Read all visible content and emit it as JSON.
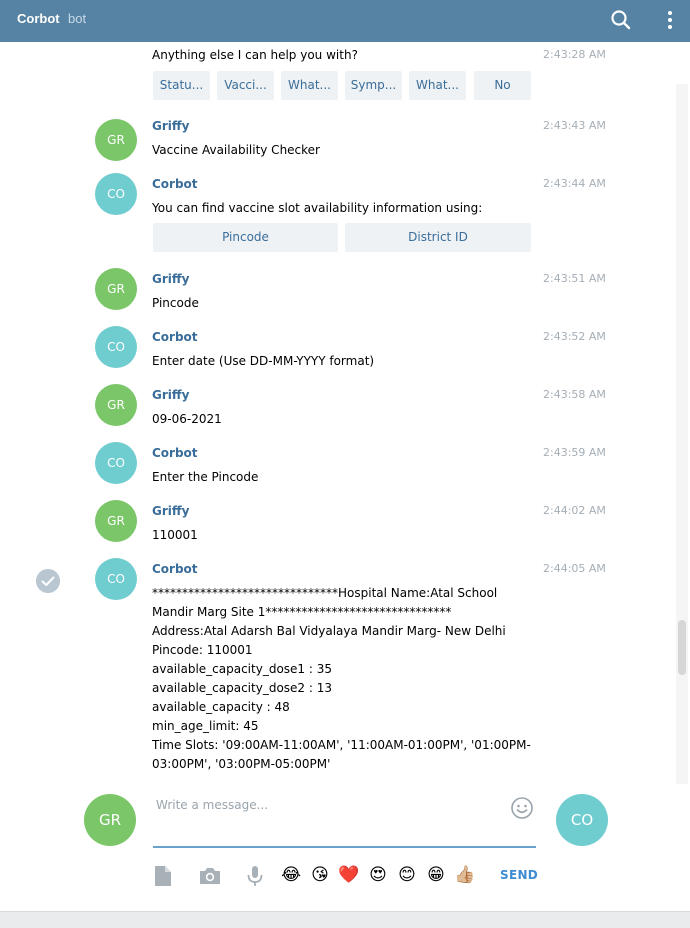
{
  "header": {
    "title": "Corbot",
    "subtitle": "bot"
  },
  "messages": [
    {
      "id": "m0",
      "author": "",
      "time": "2:43:28 AM",
      "text": "Anything else I can help you with?",
      "buttons": [
        "Statu...",
        "Vacci...",
        "What...",
        "Symp...",
        "What...",
        "No"
      ]
    },
    {
      "id": "m1",
      "avatar": "GR",
      "author": "Griffy",
      "time": "2:43:43 AM",
      "text": "Vaccine Availability Checker"
    },
    {
      "id": "m2",
      "avatar": "CO",
      "author": "Corbot",
      "time": "2:43:44 AM",
      "text": "You can find vaccine slot availability information using:",
      "buttons": [
        "Pincode",
        "District ID"
      ]
    },
    {
      "id": "m3",
      "avatar": "GR",
      "author": "Griffy",
      "time": "2:43:51 AM",
      "text": "Pincode"
    },
    {
      "id": "m4",
      "avatar": "CO",
      "author": "Corbot",
      "time": "2:43:52 AM",
      "text": "Enter date (Use DD-MM-YYYY format)"
    },
    {
      "id": "m5",
      "avatar": "GR",
      "author": "Griffy",
      "time": "2:43:58 AM",
      "text": "09-06-2021"
    },
    {
      "id": "m6",
      "avatar": "CO",
      "author": "Corbot",
      "time": "2:43:59 AM",
      "text": "Enter the Pincode"
    },
    {
      "id": "m7",
      "avatar": "GR",
      "author": "Griffy",
      "time": "2:44:02 AM",
      "text": "110001"
    },
    {
      "id": "m8",
      "avatar": "CO",
      "author": "Corbot",
      "time": "2:44:05 AM",
      "lines": [
        "*******************************Hospital Name:Atal School",
        "Mandir Marg Site 1*******************************",
        "Address:Atal Adarsh Bal Vidyalaya Mandir Marg- New Delhi",
        "Pincode: 110001",
        "available_capacity_dose1 : 35",
        "available_capacity_dose2 : 13",
        "available_capacity : 48",
        "min_age_limit: 45",
        "Time Slots: '09:00AM-11:00AM', '11:00AM-01:00PM', '01:00PM-",
        "03:00PM', '03:00PM-05:00PM'"
      ]
    }
  ],
  "composer": {
    "placeholder": "Write a message...",
    "me_avatar": "GR",
    "peer_avatar": "CO",
    "send_label": "SEND",
    "emojis": [
      "😂",
      "😘",
      "❤️",
      "😍",
      "😊",
      "😁",
      "👍🏼"
    ]
  },
  "colors": {
    "header": "#5682a3",
    "link": "#3a6d99",
    "avatar_gr": "#7ac668",
    "avatar_co": "#6fcccf",
    "send": "#3d8bd0"
  }
}
